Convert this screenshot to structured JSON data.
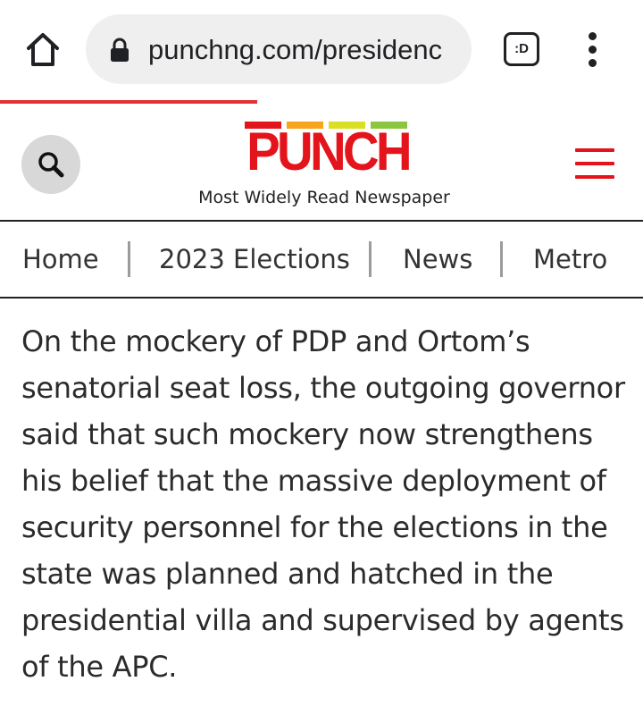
{
  "browser": {
    "url": "punchng.com/presidenc",
    "tab_icon_label": ":D",
    "load_progress": 0.4
  },
  "site": {
    "logo_text": "PUNCH",
    "tagline": "Most Widely Read Newspaper",
    "logo_bar_colors": [
      "#e3141b",
      "#f7a51c",
      "#d9e021",
      "#8cc63f"
    ],
    "brand_color": "#e3141b"
  },
  "nav": {
    "items": [
      {
        "label": "Home"
      },
      {
        "label": "2023 Elections"
      },
      {
        "label": "News"
      },
      {
        "label": "Metro"
      }
    ]
  },
  "article": {
    "paragraph": "On the mockery of PDP and Ortom’s senatorial seat loss, the outgoing governor said that such mockery now strengthens his belief that the massive deployment of security personnel for the elections in the state was planned and hatched in the presidential villa and supervised by agents of the APC."
  },
  "icons": {
    "home": "home-icon",
    "lock": "lock-icon",
    "tabs": "tab-switcher-icon",
    "menu": "more-vert-icon",
    "search": "search-icon",
    "hamburger": "hamburger-menu-icon"
  }
}
